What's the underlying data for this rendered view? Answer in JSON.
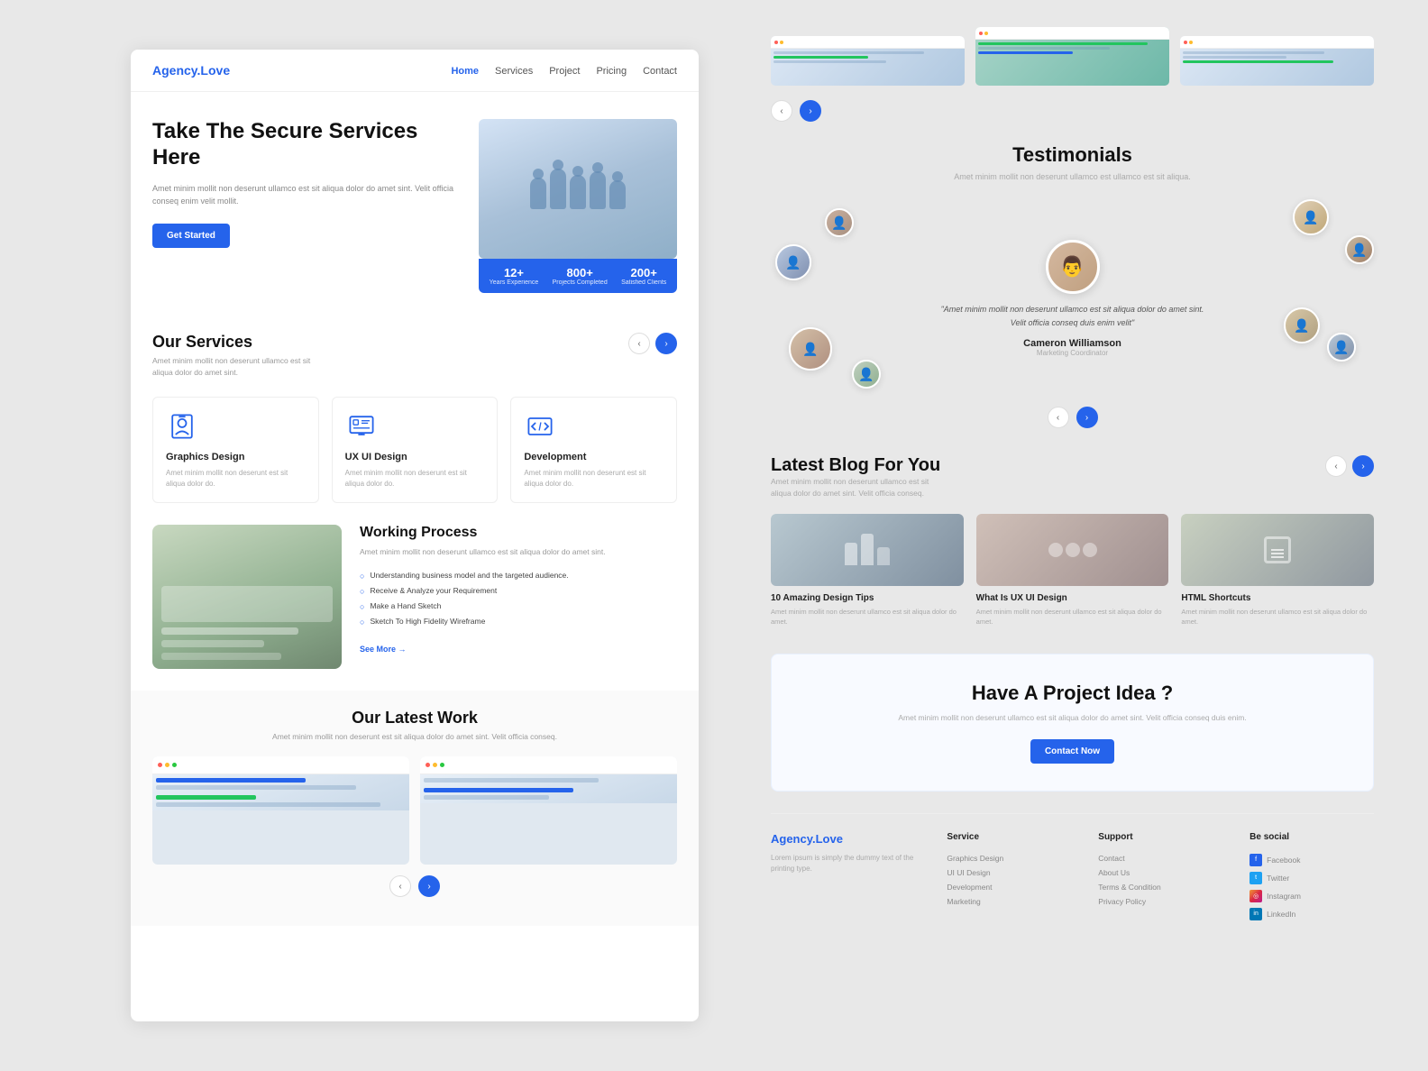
{
  "nav": {
    "logo": "Agency.Love",
    "links": [
      "Home",
      "Services",
      "Project",
      "Pricing",
      "Contact"
    ],
    "active": "Home"
  },
  "hero": {
    "title": "Take The Secure Services Here",
    "description": "Amet minim mollit non deserunt ullamco est sit aliqua dolor do amet sint. Velit officia conseq enim velit mollit.",
    "cta": "Get Started",
    "stats": [
      {
        "number": "12+",
        "label": "Years Experience"
      },
      {
        "number": "800+",
        "label": "Projects Completed"
      },
      {
        "number": "200+",
        "label": "Satisfied Clients"
      }
    ]
  },
  "services": {
    "title": "Our Services",
    "description": "Amet minim mollit non deserunt ullamco est sit aliqua dolor do amet sint.",
    "items": [
      {
        "name": "Graphics Design",
        "description": "Amet minim mollit non deserunt est sit aliqua dolor do."
      },
      {
        "name": "UX UI Design",
        "description": "Amet minim mollit non deserunt est sit aliqua dolor do."
      },
      {
        "name": "Development",
        "description": "Amet minim mollit non deserunt est sit aliqua dolor do."
      }
    ]
  },
  "working_process": {
    "title": "Working Process",
    "description": "Amet minim mollit non deserunt ullamco est sit aliqua dolor do amet sint.",
    "steps": [
      "Understanding business model and the targeted audience.",
      "Receive & Analyze your Requirement",
      "Make a Hand Sketch",
      "Sketch To High Fidelity Wireframe"
    ],
    "see_more": "See More →"
  },
  "latest_work": {
    "title": "Our Latest Work",
    "description": "Amet minim mollit non deserunt est sit aliqua dolor do amet sint. Velit officia conseq."
  },
  "testimonials": {
    "title": "Testimonials",
    "description": "Amet minim mollit non deserunt ullamco est ullamco est sit aliqua.",
    "main": {
      "quote": "\"Amet minim mollit non deserunt ullamco est sit aliqua dolor do amet sint. Velit officia conseq duis enim velit\"",
      "name": "Cameron Williamson",
      "role": "Marketing Coordinator"
    }
  },
  "blog": {
    "title": "Latest Blog For You",
    "description": "Amet minim mollit non deserunt ullamco est sit aliqua dolor do amet sint. Velit officia conseq.",
    "posts": [
      {
        "title": "10 Amazing Design Tips",
        "description": "Amet minim mollit non deserunt ullamco est sit aliqua dolor do amet."
      },
      {
        "title": "What Is UX UI Design",
        "description": "Amet minim mollit non deserunt ullamco est sit aliqua dolor do amet."
      },
      {
        "title": "HTML Shortcuts",
        "description": "Amet minim mollit non deserunt ullamco est sit aliqua dolor do amet."
      }
    ]
  },
  "cta": {
    "title": "Have A Project Idea ?",
    "description": "Amet minim mollit non deserunt ullamco est sit aliqua dolor do amet sint. Velit officia conseq duis enim.",
    "button": "Contact Now"
  },
  "footer": {
    "logo": "Agency.Love",
    "brand_desc": "Lorem ipsum is simply the dummy text of the printing type.",
    "columns": [
      {
        "title": "Service",
        "links": [
          "Graphics Design",
          "UI UI Design",
          "Development",
          "Marketing"
        ]
      },
      {
        "title": "Support",
        "links": [
          "Contact",
          "About Us",
          "Terms & Condition",
          "Privacy Policy"
        ]
      },
      {
        "title": "Be social",
        "social": [
          {
            "name": "Facebook",
            "platform": "fb"
          },
          {
            "name": "Twitter",
            "platform": "tw"
          },
          {
            "name": "Instagram",
            "platform": "ig"
          },
          {
            "name": "LinkedIn",
            "platform": "li"
          }
        ]
      }
    ]
  }
}
